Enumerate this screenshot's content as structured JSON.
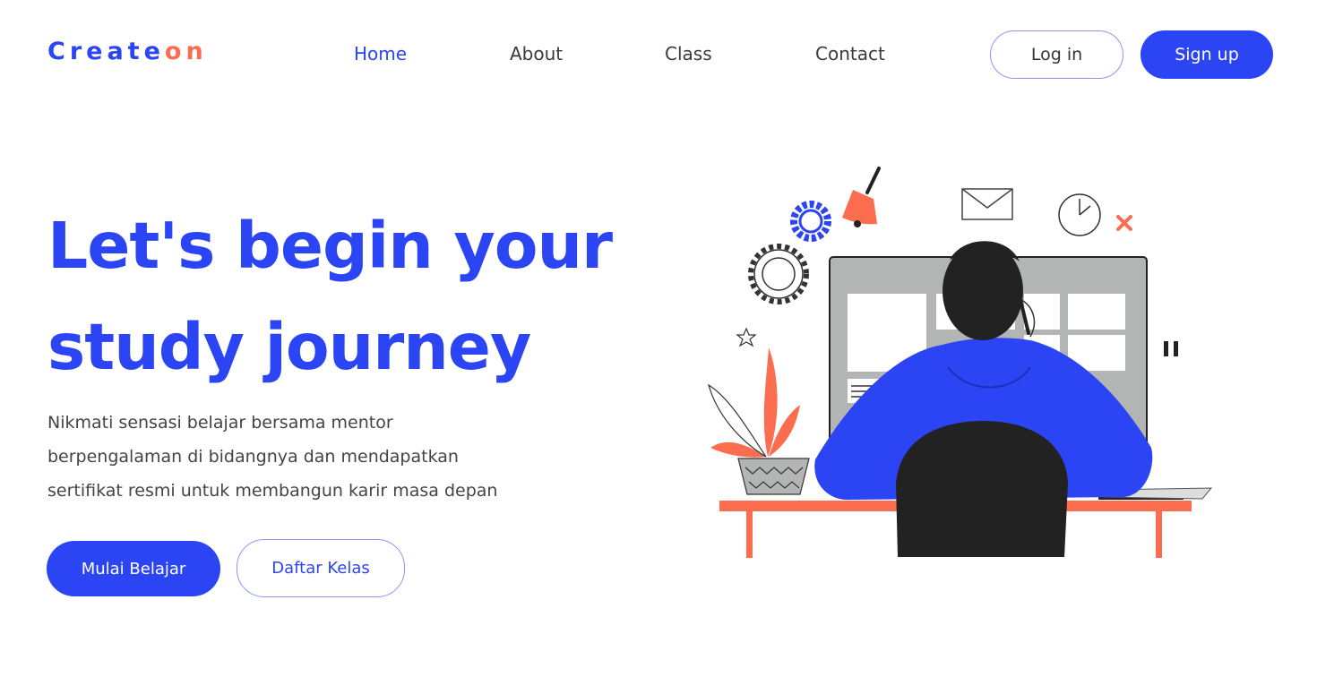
{
  "brand": {
    "name_part1": "Create",
    "name_part2": "on"
  },
  "nav": {
    "items": [
      {
        "label": "Home"
      },
      {
        "label": "About"
      },
      {
        "label": "Class"
      },
      {
        "label": "Contact"
      }
    ],
    "active": "Home"
  },
  "auth": {
    "login_label": "Log in",
    "signup_label": "Sign up"
  },
  "hero": {
    "title_line1": "Let's begin your",
    "title_line2": "study journey",
    "desc_line1": "Nikmati sensasi belajar bersama mentor",
    "desc_line2": "berpengalaman di bidangnya dan mendapatkan",
    "desc_line3": "sertifikat resmi untuk membangun karir masa depan",
    "primary_cta": "Mulai Belajar",
    "secondary_cta": "Daftar Kelas"
  },
  "colors": {
    "primary": "#2b45f5",
    "accent": "#fb6d4e",
    "text": "#444444",
    "dark": "#222222",
    "grey": "#b3b5b4"
  },
  "illustration": {
    "icon": "person-at-desk-illustration"
  }
}
